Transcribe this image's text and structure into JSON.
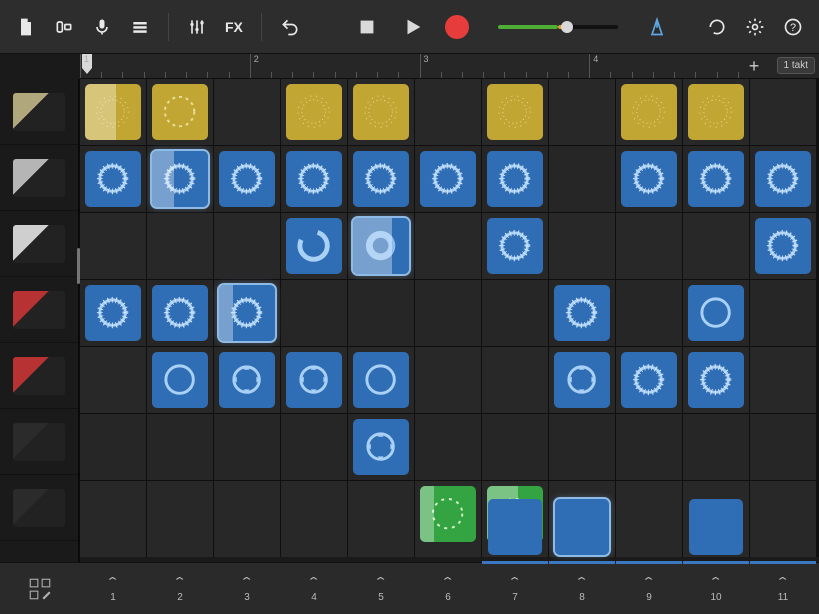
{
  "toolbar": {
    "icons": {
      "document": "document-icon",
      "camera_track": "browser-icon",
      "mic": "mic-icon",
      "list": "controls-icon",
      "sliders": "mixer-icon",
      "fx": "FX",
      "undo": "undo-icon",
      "stop": "stop-icon",
      "play": "play-icon",
      "record": "record-icon",
      "metronome": "metronome-icon",
      "loop": "loop-icon",
      "settings": "settings-icon",
      "help": "help-icon"
    },
    "volume_percent": 58
  },
  "ruler": {
    "bars": [
      "1",
      "2",
      "3",
      "4"
    ],
    "unit_label": "1 takt",
    "playhead_bar": 1.02
  },
  "tracks": [
    {
      "name": "drum-machine-1",
      "color": "#b0a77c"
    },
    {
      "name": "drum-machine-2",
      "color": "#b5b5b5"
    },
    {
      "name": "synth-bass",
      "color": "#cfcfcf"
    },
    {
      "name": "keyboard-red-1",
      "color": "#b73232"
    },
    {
      "name": "keyboard-red-2",
      "color": "#b73232"
    },
    {
      "name": "keyboard-black-1",
      "color": "#2b2b2b"
    },
    {
      "name": "keyboard-black-2",
      "color": "#2b2b2b"
    }
  ],
  "columns": [
    "1",
    "2",
    "3",
    "4",
    "5",
    "6",
    "7",
    "8",
    "9",
    "10",
    "11"
  ],
  "active_columns_from": 7,
  "cells": [
    {
      "row": 0,
      "col": 0,
      "color": "yellow",
      "glyph": "spark",
      "playing": 55
    },
    {
      "row": 0,
      "col": 1,
      "color": "yellow",
      "glyph": "dotted"
    },
    {
      "row": 0,
      "col": 3,
      "color": "yellow",
      "glyph": "spark"
    },
    {
      "row": 0,
      "col": 4,
      "color": "yellow",
      "glyph": "spark"
    },
    {
      "row": 0,
      "col": 6,
      "color": "yellow",
      "glyph": "spark"
    },
    {
      "row": 0,
      "col": 8,
      "color": "yellow",
      "glyph": "spark"
    },
    {
      "row": 0,
      "col": 9,
      "color": "yellow",
      "glyph": "spark"
    },
    {
      "row": 1,
      "col": 0,
      "color": "blue",
      "glyph": "wave"
    },
    {
      "row": 1,
      "col": 1,
      "color": "blue",
      "glyph": "wave",
      "playing": 40,
      "selected": true
    },
    {
      "row": 1,
      "col": 2,
      "color": "blue",
      "glyph": "wave"
    },
    {
      "row": 1,
      "col": 3,
      "color": "blue",
      "glyph": "wave"
    },
    {
      "row": 1,
      "col": 4,
      "color": "blue",
      "glyph": "wave"
    },
    {
      "row": 1,
      "col": 5,
      "color": "blue",
      "glyph": "wave"
    },
    {
      "row": 1,
      "col": 6,
      "color": "blue",
      "glyph": "wave"
    },
    {
      "row": 1,
      "col": 8,
      "color": "blue",
      "glyph": "wave"
    },
    {
      "row": 1,
      "col": 9,
      "color": "blue",
      "glyph": "wave"
    },
    {
      "row": 1,
      "col": 10,
      "color": "blue",
      "glyph": "wave"
    },
    {
      "row": 2,
      "col": 3,
      "color": "blue",
      "glyph": "ringgap"
    },
    {
      "row": 2,
      "col": 4,
      "color": "blue",
      "glyph": "wavefill",
      "playing": 70,
      "selected": true
    },
    {
      "row": 2,
      "col": 6,
      "color": "blue",
      "glyph": "wave"
    },
    {
      "row": 2,
      "col": 10,
      "color": "blue",
      "glyph": "wave"
    },
    {
      "row": 3,
      "col": 0,
      "color": "blue",
      "glyph": "wave"
    },
    {
      "row": 3,
      "col": 1,
      "color": "blue",
      "glyph": "wave"
    },
    {
      "row": 3,
      "col": 2,
      "color": "blue",
      "glyph": "wave",
      "playing": 25,
      "selected": true
    },
    {
      "row": 3,
      "col": 7,
      "color": "blue",
      "glyph": "wave"
    },
    {
      "row": 3,
      "col": 9,
      "color": "blue",
      "glyph": "ring"
    },
    {
      "row": 4,
      "col": 1,
      "color": "blue",
      "glyph": "ring"
    },
    {
      "row": 4,
      "col": 2,
      "color": "blue",
      "glyph": "ringarr"
    },
    {
      "row": 4,
      "col": 3,
      "color": "blue",
      "glyph": "ringarr"
    },
    {
      "row": 4,
      "col": 4,
      "color": "blue",
      "glyph": "ring"
    },
    {
      "row": 4,
      "col": 7,
      "color": "blue",
      "glyph": "ringarr"
    },
    {
      "row": 4,
      "col": 8,
      "color": "blue",
      "glyph": "wave"
    },
    {
      "row": 4,
      "col": 9,
      "color": "blue",
      "glyph": "wave"
    },
    {
      "row": 5,
      "col": 4,
      "color": "blue",
      "glyph": "ringarr"
    },
    {
      "row": 6,
      "col": 5,
      "color": "green",
      "glyph": "green",
      "playing": 25
    },
    {
      "row": 6,
      "col": 6,
      "color": "green",
      "glyph": "green",
      "playing": 55
    }
  ],
  "partial_row": {
    "row": 7,
    "cells": [
      {
        "col": 6,
        "color": "blue"
      },
      {
        "col": 7,
        "color": "blue",
        "selected": true
      },
      {
        "col": 9,
        "color": "blue"
      }
    ]
  }
}
